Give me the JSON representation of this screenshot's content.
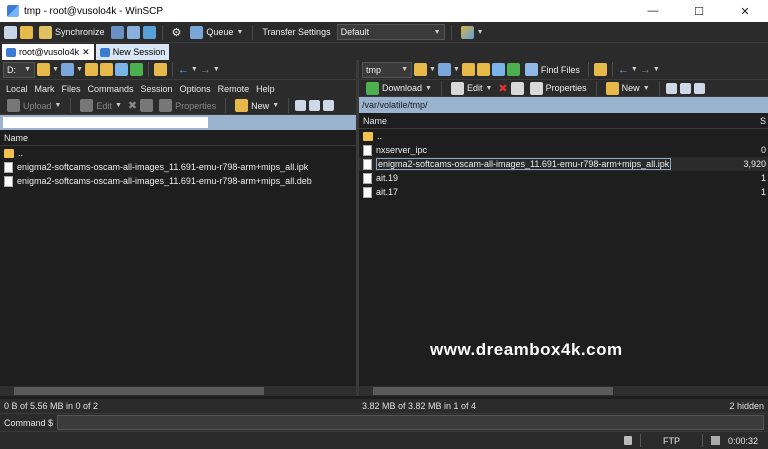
{
  "window": {
    "title": "tmp - root@vusolo4k - WinSCP"
  },
  "toolbar": {
    "synchronize": "Synchronize",
    "queue": "Queue",
    "transfer_settings_label": "Transfer Settings",
    "transfer_settings_value": "Default"
  },
  "tabs": [
    {
      "label": "root@vusolo4k"
    },
    {
      "label": "New Session"
    }
  ],
  "left": {
    "drive": "D:",
    "menu": [
      "Local",
      "Mark",
      "Files",
      "Commands",
      "Session",
      "Options",
      "Remote",
      "Help"
    ],
    "upload": "Upload",
    "edit": "Edit",
    "properties": "Properties",
    "new": "New",
    "col_name": "Name",
    "files": [
      {
        "name": ".."
      },
      {
        "name": "enigma2-softcams-oscam-all-images_11.691-emu-r798-arm+mips_all.ipk"
      },
      {
        "name": "enigma2-softcams-oscam-all-images_11.691-emu-r798-arm+mips_all.deb"
      }
    ],
    "status": "0 B of 5.56 MB in 0 of 2"
  },
  "right": {
    "drive": "tmp",
    "find_files": "Find Files",
    "download": "Download",
    "edit": "Edit",
    "properties": "Properties",
    "new": "New",
    "path": "/var/volatile/tmp/",
    "col_name": "Name",
    "col_size": "S",
    "files": [
      {
        "name": "..",
        "size": ""
      },
      {
        "name": "nxserver_ipc",
        "size": "0"
      },
      {
        "name": "enigma2-softcams-oscam-all-images_11.691-emu-r798-arm+mips_all.ipk",
        "size": "3,920"
      },
      {
        "name": "ait.19",
        "size": "1"
      },
      {
        "name": "ait.17",
        "size": "1"
      }
    ],
    "status": "3.82 MB of 3.82 MB in 1 of 4",
    "hidden": "2 hidden"
  },
  "command": {
    "label": "Command $"
  },
  "bottom": {
    "protocol": "FTP",
    "timer": "0:00:32"
  },
  "watermark": "www.dreambox4k.com"
}
